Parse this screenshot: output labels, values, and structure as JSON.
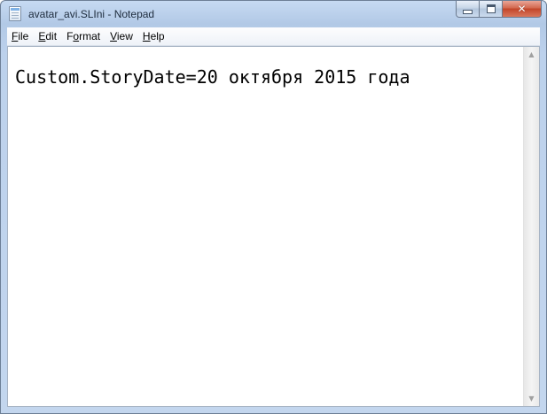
{
  "window": {
    "title": "avatar_avi.SLIni - Notepad",
    "icon": "notepad-icon",
    "controls": {
      "minimize_icon": "minimize-icon",
      "maximize_icon": "maximize-icon",
      "close_glyph": "✕"
    }
  },
  "menu": {
    "items": [
      {
        "underline": "F",
        "rest": "ile"
      },
      {
        "underline": "E",
        "rest": "dit"
      },
      {
        "pre": "F",
        "underline": "o",
        "rest": "rmat"
      },
      {
        "underline": "V",
        "rest": "iew"
      },
      {
        "underline": "H",
        "rest": "elp"
      }
    ]
  },
  "editor": {
    "content": "Custom.StoryDate=20 октября 2015 года"
  },
  "scrollbar": {
    "up_arrow": "▲",
    "down_arrow": "▼"
  },
  "colors": {
    "frame": "#b9cfea",
    "close_button": "#c7492d",
    "text": "#000000"
  }
}
